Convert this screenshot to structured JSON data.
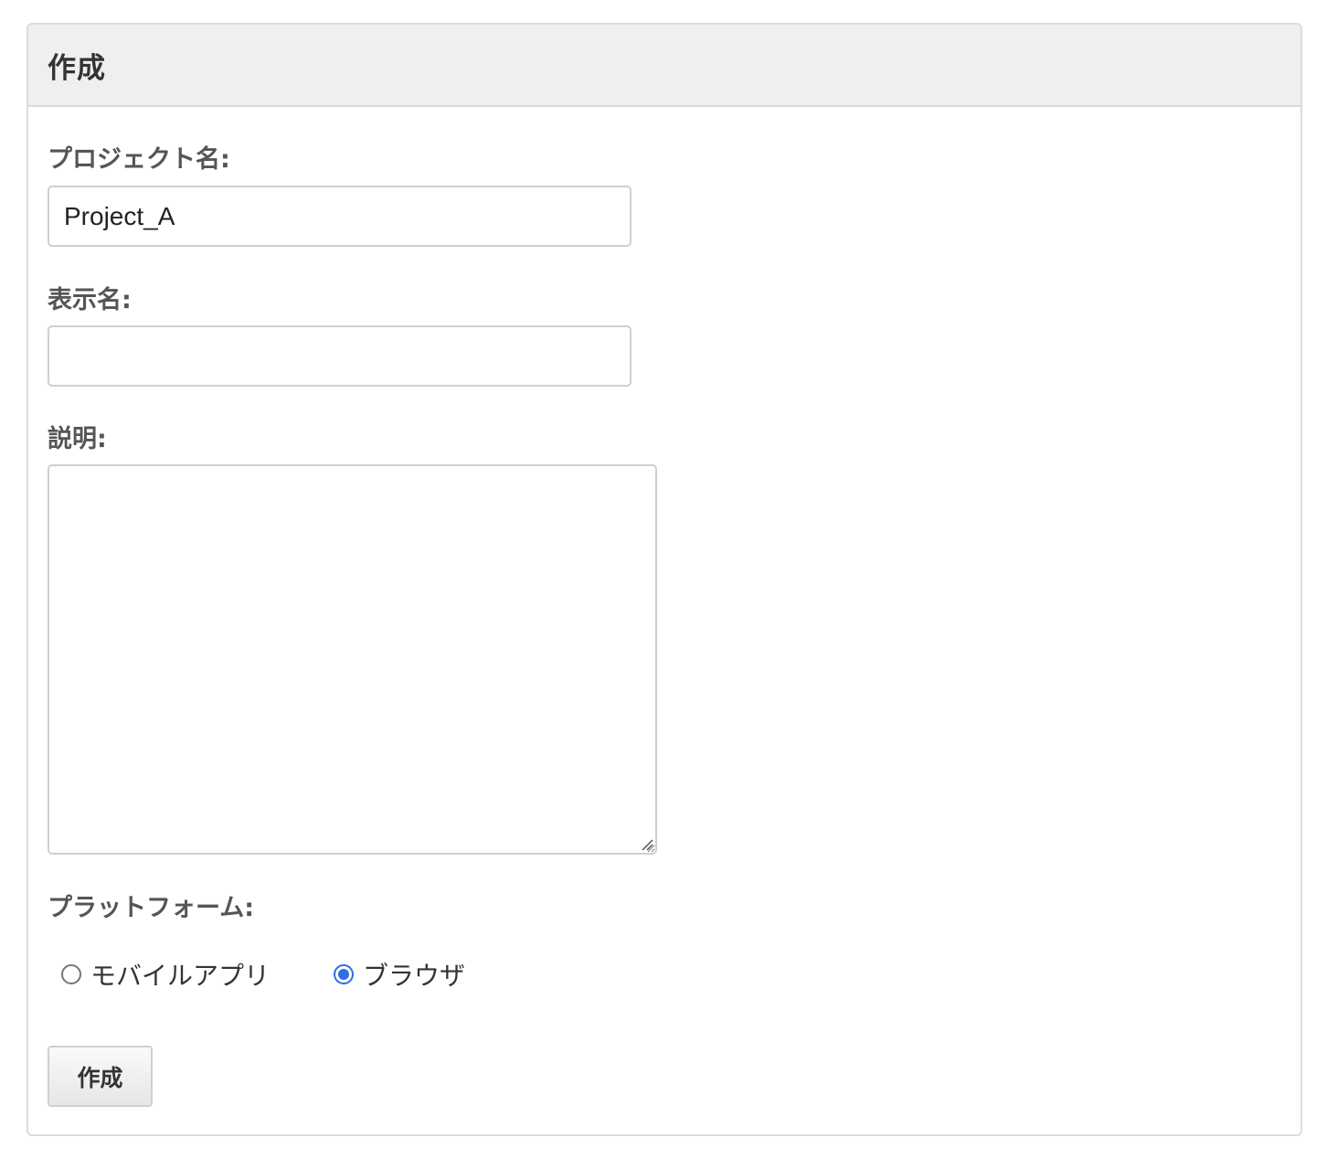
{
  "header": {
    "title": "作成"
  },
  "form": {
    "project_name": {
      "label": "プロジェクト名:",
      "value": "Project_A"
    },
    "display_name": {
      "label": "表示名:",
      "value": ""
    },
    "description": {
      "label": "説明:",
      "value": ""
    },
    "platform": {
      "label": "プラットフォーム:",
      "options": [
        {
          "label": "モバイルアプリ",
          "checked": false
        },
        {
          "label": "ブラウザ",
          "checked": true
        }
      ]
    },
    "submit_label": "作成"
  },
  "colors": {
    "accent": "#2f6fe0",
    "header_bg": "#efefef",
    "border": "#dcdcdc"
  }
}
